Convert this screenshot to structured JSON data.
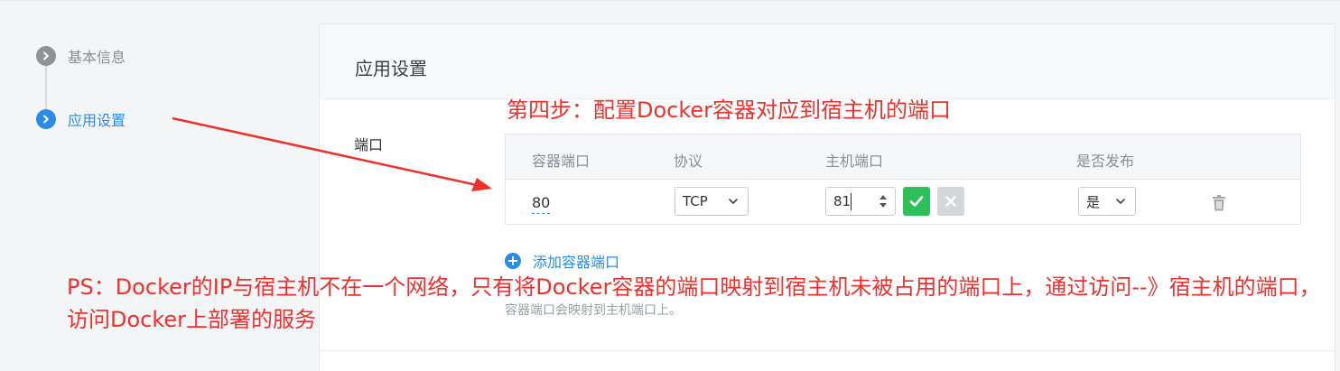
{
  "steps": [
    {
      "number": "1",
      "label": "基本信息",
      "state": "done"
    },
    {
      "number": "2",
      "label": "应用设置",
      "state": "active"
    }
  ],
  "card": {
    "title": "应用设置",
    "field_label": "端口"
  },
  "port_table": {
    "headers": [
      "容器端口",
      "协议",
      "主机端口",
      "是否发布"
    ],
    "rows": [
      {
        "container_port": "80",
        "protocol": "TCP",
        "host_port": "81",
        "publish": "是"
      }
    ]
  },
  "add_port_label": "添加容器端口",
  "hint": "容器端口会映射到主机端口上。",
  "annotations": {
    "step_note": "第四步：配置Docker容器对应到宿主机的端口",
    "ps_note": "PS：Docker的IP与宿主机不在一个网络，只有将Docker容器的端口映射到宿主机未被占用的端口上，通过访问--》宿主机的端口，访问Docker上部署的服务"
  },
  "colors": {
    "primary": "#2b8be6",
    "confirm": "#2dbf5a",
    "annotation": "#f0302d",
    "muted": "#8f9398"
  },
  "icons": {
    "step_done": "chevron-right-icon",
    "step_active": "chevron-right-icon",
    "confirm": "check-icon",
    "cancel": "close-icon",
    "delete": "trash-icon",
    "add": "plus-circle-icon",
    "arrow": "annotation-arrow"
  }
}
